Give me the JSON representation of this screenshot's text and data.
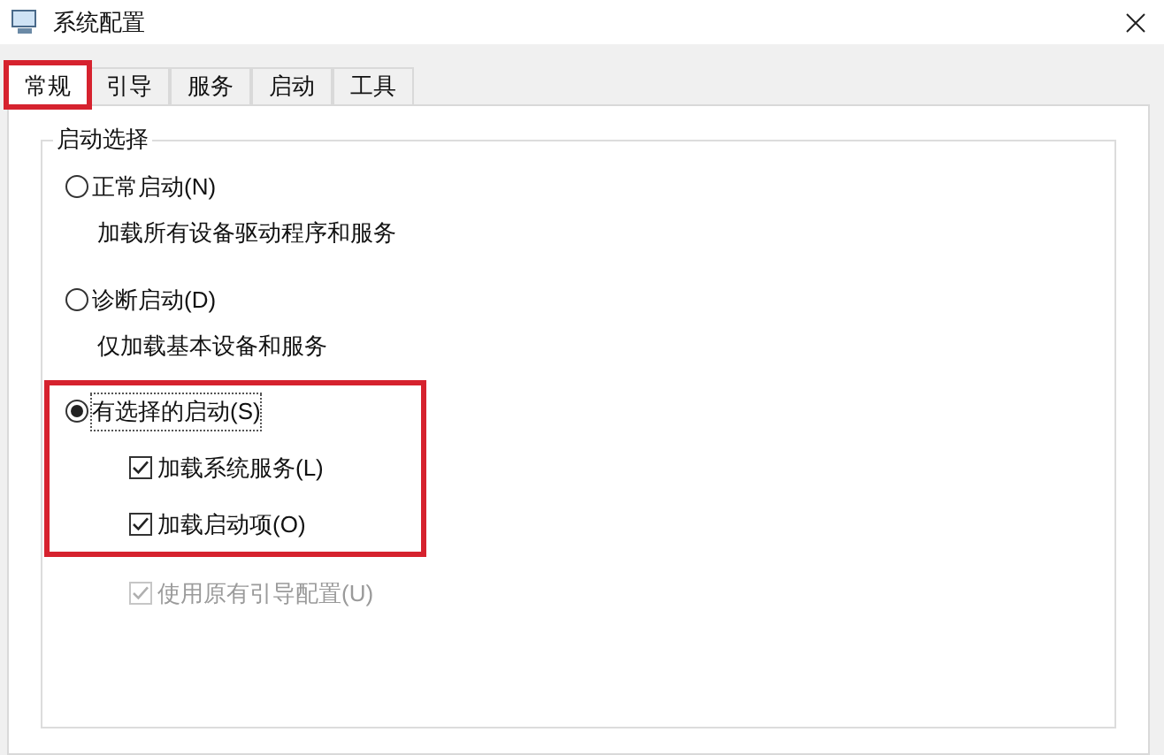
{
  "window": {
    "title": "系统配置"
  },
  "tabs": [
    {
      "label": "常规",
      "selected": true,
      "highlighted": true
    },
    {
      "label": "引导",
      "selected": false,
      "highlighted": false
    },
    {
      "label": "服务",
      "selected": false,
      "highlighted": false
    },
    {
      "label": "启动",
      "selected": false,
      "highlighted": false
    },
    {
      "label": "工具",
      "selected": false,
      "highlighted": false
    }
  ],
  "group": {
    "title": "启动选择",
    "options": [
      {
        "label": "正常启动(N)",
        "selected": false,
        "highlighted": false,
        "description": "加载所有设备驱动程序和服务"
      },
      {
        "label": "诊断启动(D)",
        "selected": false,
        "highlighted": false,
        "description": "仅加载基本设备和服务"
      },
      {
        "label": "有选择的启动(S)",
        "selected": true,
        "highlighted": true,
        "checkboxes": [
          {
            "label": "加载系统服务(L)",
            "checked": true,
            "disabled": false
          },
          {
            "label": "加载启动项(O)",
            "checked": true,
            "disabled": false
          }
        ]
      }
    ],
    "extra_checkboxes": [
      {
        "label": "使用原有引导配置(U)",
        "checked": true,
        "disabled": true
      }
    ]
  }
}
